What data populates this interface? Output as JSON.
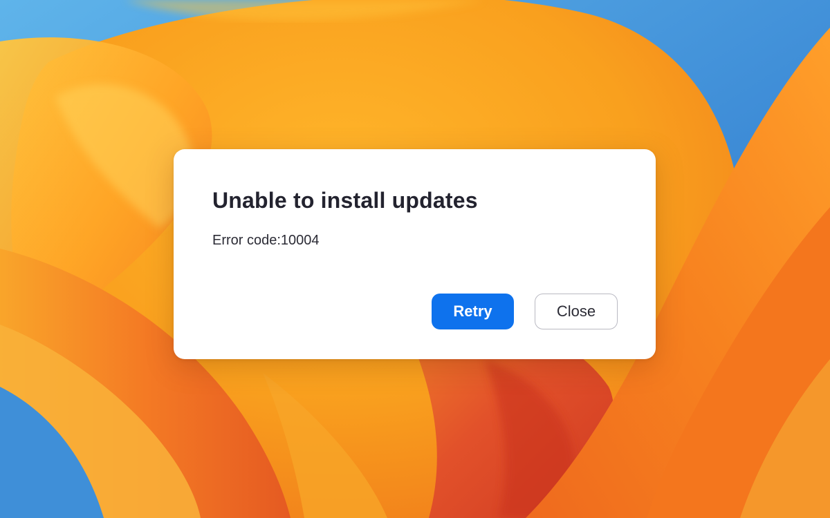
{
  "dialog": {
    "title": "Unable to install updates",
    "message": "Error code:10004",
    "buttons": {
      "retry_label": "Retry",
      "close_label": "Close"
    }
  },
  "colors": {
    "primary_button": "#0e72ed",
    "title_text": "#23232f",
    "wallpaper_orange": "#f7a21b",
    "wallpaper_blue": "#3e8fd6"
  }
}
